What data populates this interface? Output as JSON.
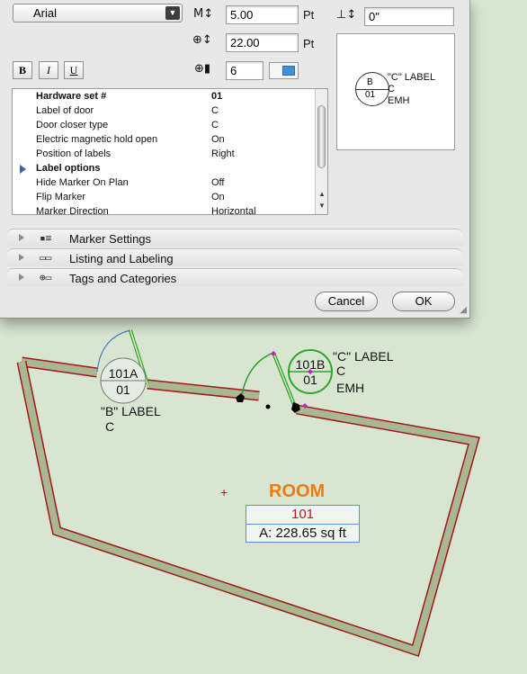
{
  "font": {
    "family_value": "Arial"
  },
  "text_size": {
    "icon": "M↕",
    "value": "5.00",
    "unit": "Pt"
  },
  "leading": {
    "icon": "⊕↕",
    "value": "22.00",
    "unit": "Pt"
  },
  "pen": {
    "icon": "⊕▮",
    "value": "6"
  },
  "offset": {
    "icon": "⊥↕",
    "value": "0\""
  },
  "style_buttons": {
    "bold": "B",
    "italic": "I",
    "underline": "U"
  },
  "preview": {
    "top": "B",
    "bottom": "01",
    "line1": "\"C\" LABEL",
    "line2": "C",
    "line3": "EMH"
  },
  "settings": [
    {
      "key": "Hardware set #",
      "value": "01",
      "bold": true
    },
    {
      "key": "Label of door",
      "value": "C"
    },
    {
      "key": "Door closer type",
      "value": "C"
    },
    {
      "key": "Electric magnetic hold open",
      "value": "On"
    },
    {
      "key": "Position of labels",
      "value": "Right"
    },
    {
      "key": "Label options",
      "value": "",
      "bold": true,
      "group": true
    },
    {
      "key": "Hide Marker On Plan",
      "value": "Off"
    },
    {
      "key": "Flip Marker",
      "value": "On"
    },
    {
      "key": "Marker Direction",
      "value": "Horizontal"
    }
  ],
  "panels": [
    {
      "icon": "▪≡",
      "label": "Marker Settings"
    },
    {
      "icon": "▭▭",
      "label": "Listing and Labeling"
    },
    {
      "icon": "⊕▭",
      "label": "Tags and Categories"
    }
  ],
  "buttons": {
    "cancel": "Cancel",
    "ok": "OK"
  },
  "plan": {
    "door_a": {
      "id": "101A",
      "set": "01",
      "label1": "\"B\" LABEL",
      "label2": "C"
    },
    "door_b": {
      "id": "101B",
      "set": "01",
      "label1": "\"C\" LABEL",
      "label2": "C",
      "label3": "EMH"
    },
    "room": {
      "name": "ROOM",
      "number": "101",
      "area": "A: 228.65 sq ft"
    }
  },
  "colors": {
    "wall_fill": "#a9b893",
    "wall_edge": "#a01818",
    "door_green": "#2fa52f",
    "room_name": "#f07a0f",
    "background": "#d7e5d1"
  }
}
